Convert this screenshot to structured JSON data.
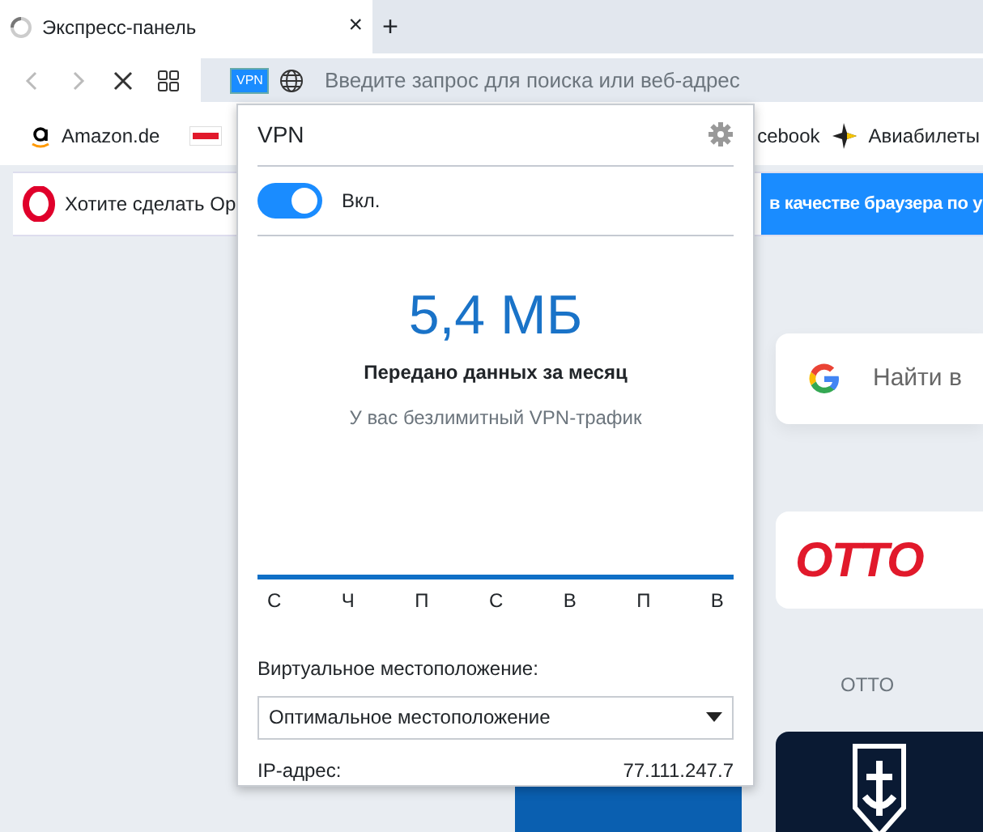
{
  "tab": {
    "title": "Экспресс-панель",
    "close": "×",
    "new_tab": "+",
    "loading": true
  },
  "address_bar": {
    "vpn_badge": "VPN",
    "placeholder": "Введите запрос для поиска или веб-адрес"
  },
  "bookmarks_left": [
    {
      "label": "Amazon.de"
    }
  ],
  "bookmarks_right": [
    {
      "label": "cebook"
    },
    {
      "label": "Авиабилеты"
    }
  ],
  "notification": {
    "text": "Хотите сделать Op",
    "button": "в качестве браузера по у"
  },
  "speed_dial": {
    "search_placeholder": "Найти в",
    "tiles": [
      {
        "logo": "OTTO",
        "caption": "OTTO"
      }
    ]
  },
  "vpn_popup": {
    "title": "VPN",
    "toggle": {
      "on": true,
      "label": "Вкл."
    },
    "usage": "5,4 МБ",
    "usage_label": "Передано данных за месяц",
    "note": "У вас безлимитный VPN-трафик",
    "chart": {
      "days": [
        "С",
        "Ч",
        "П",
        "С",
        "В",
        "П",
        "В"
      ]
    },
    "location_label": "Виртуальное местоположение:",
    "location": "Оптимальное местоположение",
    "ip_label": "IP-адрес:",
    "ip": "77.111.247.7"
  }
}
